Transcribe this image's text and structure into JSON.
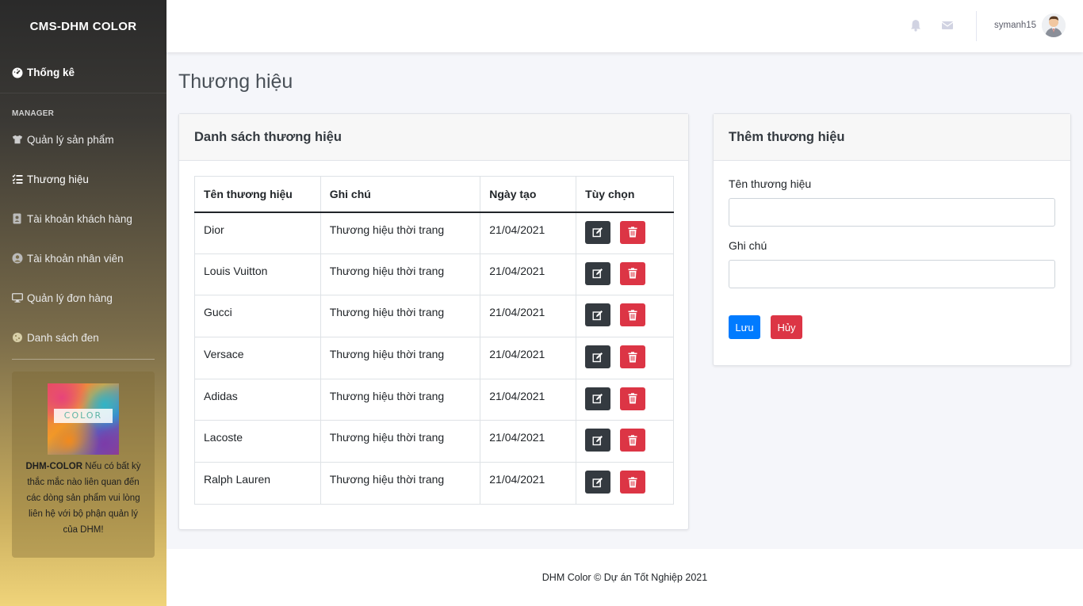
{
  "sidebar": {
    "brand": "CMS-DHM COLOR",
    "dashboard": {
      "label": "Thống kê",
      "icon": "tachometer-icon"
    },
    "section_label": "MANAGER",
    "items": [
      {
        "label": "Quản lý sản phẩm",
        "icon": "tshirt-icon"
      },
      {
        "label": "Thương hiệu",
        "icon": "list-check-icon"
      },
      {
        "label": "Tài khoản khách hàng",
        "icon": "address-book-icon"
      },
      {
        "label": "Tài khoản nhân viên",
        "icon": "user-circle-icon"
      },
      {
        "label": "Quản lý đơn hàng",
        "icon": "desktop-icon"
      },
      {
        "label": "Danh sách đen",
        "icon": "cookie-icon"
      }
    ],
    "promo": {
      "image_text": "COLOR",
      "brand": "DHM-COLOR",
      "text": " Nếu có bất kỳ thắc mắc nào liên quan đến các dòng sản phẩm vui lòng liên hệ với bộ phận quản lý của DHM!"
    }
  },
  "header": {
    "username": "symanh15"
  },
  "page": {
    "title": "Thương hiệu"
  },
  "list": {
    "title": "Danh sách thương hiệu",
    "columns": [
      "Tên thương hiệu",
      "Ghi chú",
      "Ngày tạo",
      "Tùy chọn"
    ],
    "rows": [
      {
        "name": "Dior",
        "note": "Thương hiệu thời trang",
        "date": "21/04/2021"
      },
      {
        "name": "Louis Vuitton",
        "note": "Thương hiệu thời trang",
        "date": "21/04/2021"
      },
      {
        "name": "Gucci",
        "note": "Thương hiệu thời trang",
        "date": "21/04/2021"
      },
      {
        "name": "Versace",
        "note": "Thương hiệu thời trang",
        "date": "21/04/2021"
      },
      {
        "name": "Adidas",
        "note": "Thương hiệu thời trang",
        "date": "21/04/2021"
      },
      {
        "name": "Lacoste",
        "note": "Thương hiệu thời trang",
        "date": "21/04/2021"
      },
      {
        "name": "Ralph Lauren",
        "note": "Thương hiệu thời trang",
        "date": "21/04/2021"
      }
    ]
  },
  "form": {
    "title": "Thêm thương hiệu",
    "name_label": "Tên thương hiệu",
    "name_value": "",
    "note_label": "Ghi chú",
    "note_value": "",
    "save_label": "Lưu",
    "cancel_label": "Hủy"
  },
  "footer": {
    "text": "DHM Color © Dự án Tốt Nghiệp 2021"
  },
  "colors": {
    "primary": "#007bff",
    "danger": "#dc3545",
    "dark": "#343a40"
  }
}
